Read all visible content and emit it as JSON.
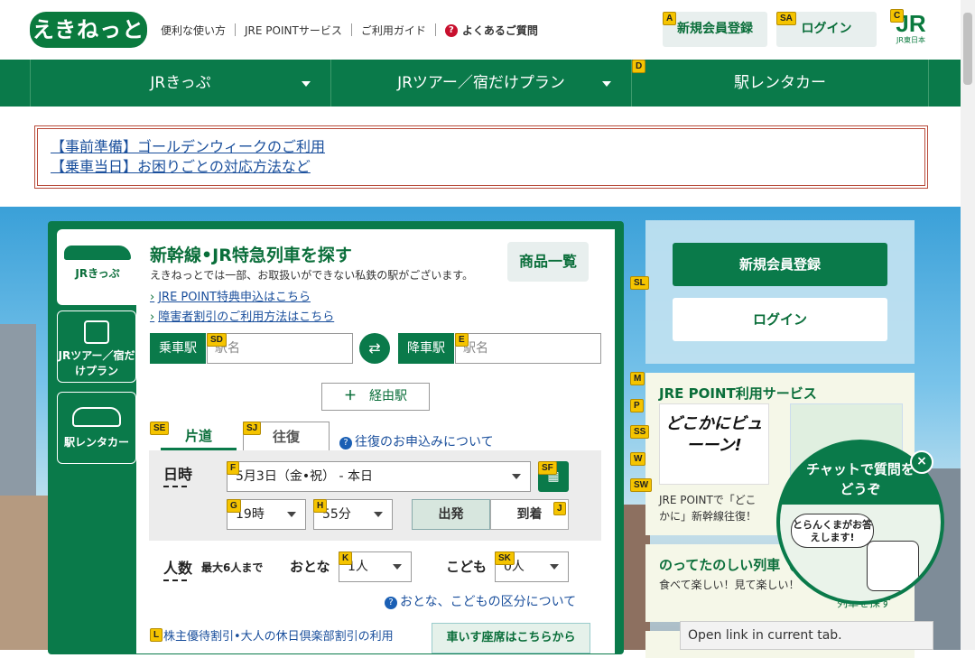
{
  "header": {
    "logo": "えきねっと",
    "links": [
      "便利な使い方",
      "JRE POINTサービス",
      "ご利用ガイド"
    ],
    "faq": "よくあるご質問",
    "register_label": "新規会員登録",
    "login_label": "ログイン",
    "jr_logo": "JR",
    "jr_logo_sub": "JR東日本"
  },
  "nav": {
    "items": [
      {
        "label": "JRきっぷ"
      },
      {
        "label": "JRツアー／宿だけプラン"
      },
      {
        "label": "駅レンタカー"
      }
    ]
  },
  "notice": {
    "links": [
      "【事前準備】ゴールデンウィークのご利用",
      "【乗車当日】お困りごとの対応方法など"
    ]
  },
  "sidetabs": {
    "ticket": "JRきっぷ",
    "tour": "JRツアー／宿だけプラン",
    "rental": "駅レンタカー"
  },
  "search": {
    "title": "新幹線•JR特急列車を探す",
    "subtitle": "えきねっとでは一部、お取扱いができない私鉄の駅がございます。",
    "catalog": "商品一覧",
    "link1": "JRE POINT特典申込はこちら",
    "link2": "障害者割引のご利用方法はこちら",
    "depart_label": "乗車駅",
    "arrive_label": "降車駅",
    "station_placeholder": "駅名",
    "via": "経由駅",
    "via_icon": "＋",
    "tab_oneway": "片道",
    "tab_round": "往復",
    "round_info": "往復のお申込みについて",
    "date_label": "日時",
    "date_value": "5月3日（金•祝） - 本日",
    "hour": "19時",
    "minute": "55分",
    "depart_toggle": "出発",
    "arrive_toggle": "到着",
    "people_label": "人数",
    "people_max": "最大6人まで",
    "adult_label": "おとな",
    "adult_value": "1人",
    "child_label": "こども",
    "child_value": "0人",
    "age_info": "おとな、こどもの区分について",
    "discount": "株主優待割引•大人の休日倶楽部割引の利用",
    "wheelchair": "車いす座席はこちらから"
  },
  "right": {
    "register": "新規会員登録",
    "login": "ログイン",
    "jrep_title": "JRE POINT利用サービス",
    "banner_text": "どこかにビューーン!",
    "jrep_caption": "JRE POINTで「どこかに」新幹線往復！",
    "train_title": "のってたのしい列車（観",
    "train_caption": "食べて楽しい！見て楽しい！",
    "train_link": "列車を探す"
  },
  "chat": {
    "title": "チャットで質問をどうぞ",
    "bubble": "とらんくまがお答えします!"
  },
  "status_bar": "Open link in current tab.",
  "keys": {
    "A": "A",
    "SA": "SA",
    "C": "C",
    "D": "D",
    "SL": "SL",
    "SD": "SD",
    "E": "E",
    "SE": "SE",
    "SJ": "SJ",
    "F": "F",
    "SF": "SF",
    "G": "G",
    "H": "H",
    "J": "J",
    "K": "K",
    "SK": "SK",
    "L": "L",
    "M": "M",
    "P": "P",
    "SS": "SS",
    "W": "W",
    "SW": "SW"
  }
}
